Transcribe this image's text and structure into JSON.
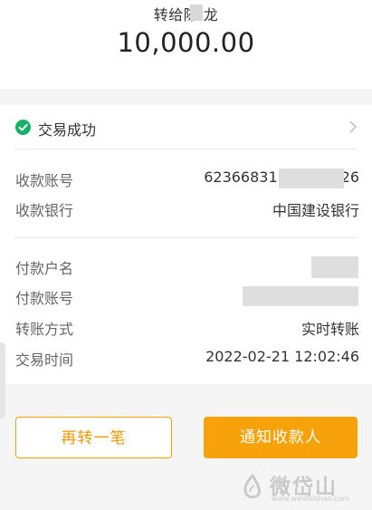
{
  "transfer": {
    "recipient_label": "转给陈 龙",
    "amount": "10,000.00"
  },
  "status": {
    "text": "交易成功",
    "icon": "check-circle-icon",
    "color": "#17b06b"
  },
  "receiver": {
    "account_label": "收款账号",
    "account_prefix": "62366831",
    "account_suffix": "26",
    "bank_label": "收款银行",
    "bank_value": "中国建设银行"
  },
  "payer": {
    "name_label": "付款户名",
    "account_label": "付款账号",
    "method_label": "转账方式",
    "method_value": "实时转账",
    "time_label": "交易时间",
    "time_value": "2022-02-21 12:02:46"
  },
  "actions": {
    "again_label": "再转一笔",
    "notify_label": "通知收款人",
    "accent": "#f7a10b"
  },
  "watermark": {
    "text": "微岱山",
    "url": "www.weidaishan.com"
  }
}
